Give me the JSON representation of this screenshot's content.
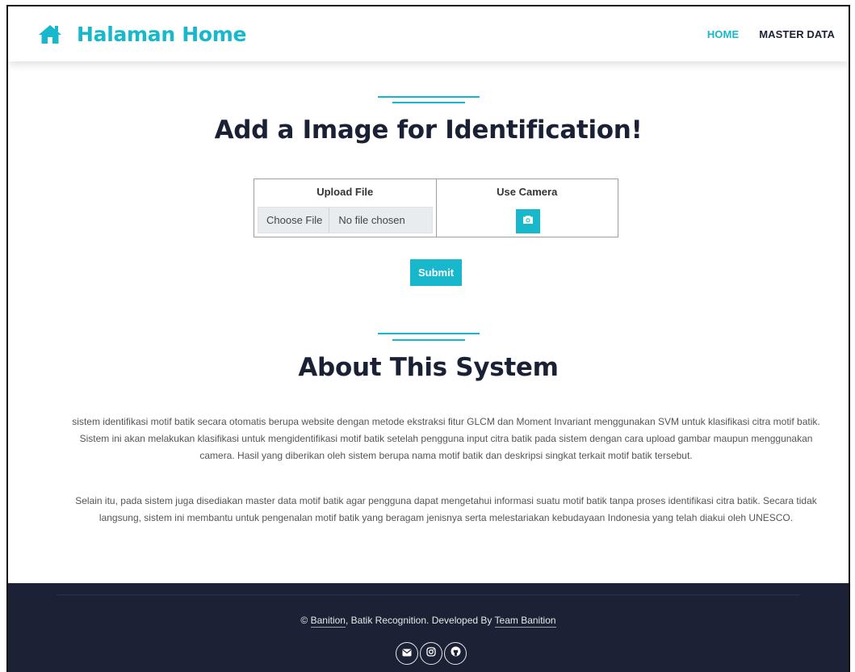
{
  "navbar": {
    "brand_icon": "home-icon",
    "brand_title": "Halaman Home",
    "links": [
      {
        "label": "HOME",
        "active": true
      },
      {
        "label": "MASTER DATA",
        "active": false
      }
    ]
  },
  "upload_section": {
    "title": "Add a Image for Identification!",
    "upload_col_label": "Upload File",
    "choose_file_label": "Choose File",
    "file_status": "No file chosen",
    "camera_col_label": "Use Camera",
    "camera_icon": "camera-icon",
    "submit_label": "Submit"
  },
  "about_section": {
    "title": "About This System",
    "paragraph1": "sistem identifikasi motif batik secara otomatis berupa website dengan metode ekstraksi fitur GLCM dan Moment Invariant menggunakan SVM untuk klasifikasi citra motif batik. Sistem ini akan melakukan klasifikasi untuk mengidentifikasi motif batik setelah pengguna input citra batik pada sistem dengan cara upload gambar maupun menggunakan camera. Hasil yang diberikan oleh sistem berupa nama motif batik dan deskripsi singkat terkait motif batik tersebut.",
    "paragraph2": "Selain itu, pada sistem juga disediakan master data motif batik agar pengguna dapat mengetahui informasi suatu motif batik tanpa proses identifikasi citra batik. Secara tidak langsung, sistem ini membantu untuk pengenalan motif batik yang beragam jenisnya serta melestariakan kebudayaan Indonesia yang telah diakui oleh UNESCO."
  },
  "footer": {
    "copyright_symbol": "©",
    "brand_link": "Banition",
    "copy_middle": ", Batik Recognition. Developed By ",
    "team_link": "Team Banition",
    "social_icons": [
      "envelope-icon",
      "instagram-icon",
      "github-icon"
    ]
  },
  "colors": {
    "accent": "#17b8cc",
    "heading": "#1b2135",
    "footer_bg": "#1c2135"
  }
}
